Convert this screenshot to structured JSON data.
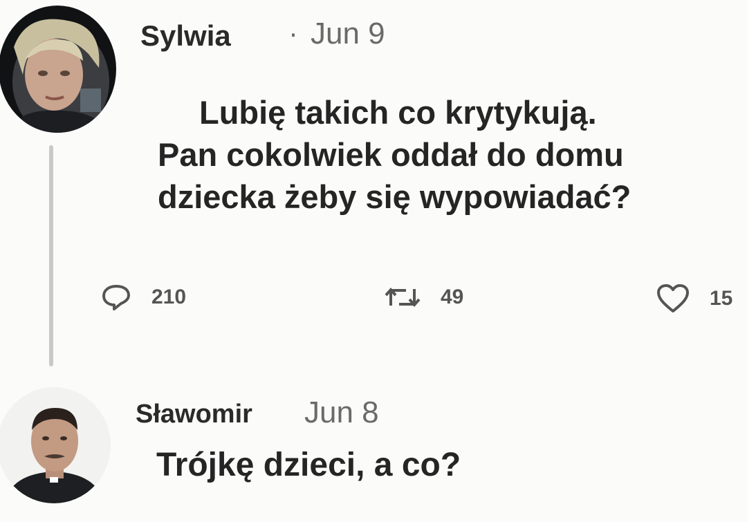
{
  "tweet": {
    "author": "Sylwia",
    "separator": "·",
    "date": "Jun 9",
    "text_lines": [
      "Lubię takich co krytykują.",
      "Pan cokolwiek oddał do domu",
      "dziecka żeby się wypowiadać?"
    ],
    "actions": {
      "replies": "210",
      "retweets": "49",
      "likes": "15"
    }
  },
  "reply": {
    "author": "Sławomir",
    "date": "Jun 8",
    "text": "Trójkę dzieci, a co?"
  },
  "icons": {
    "reply": "speech-bubble-icon",
    "retweet": "retweet-icon",
    "like": "heart-icon"
  }
}
